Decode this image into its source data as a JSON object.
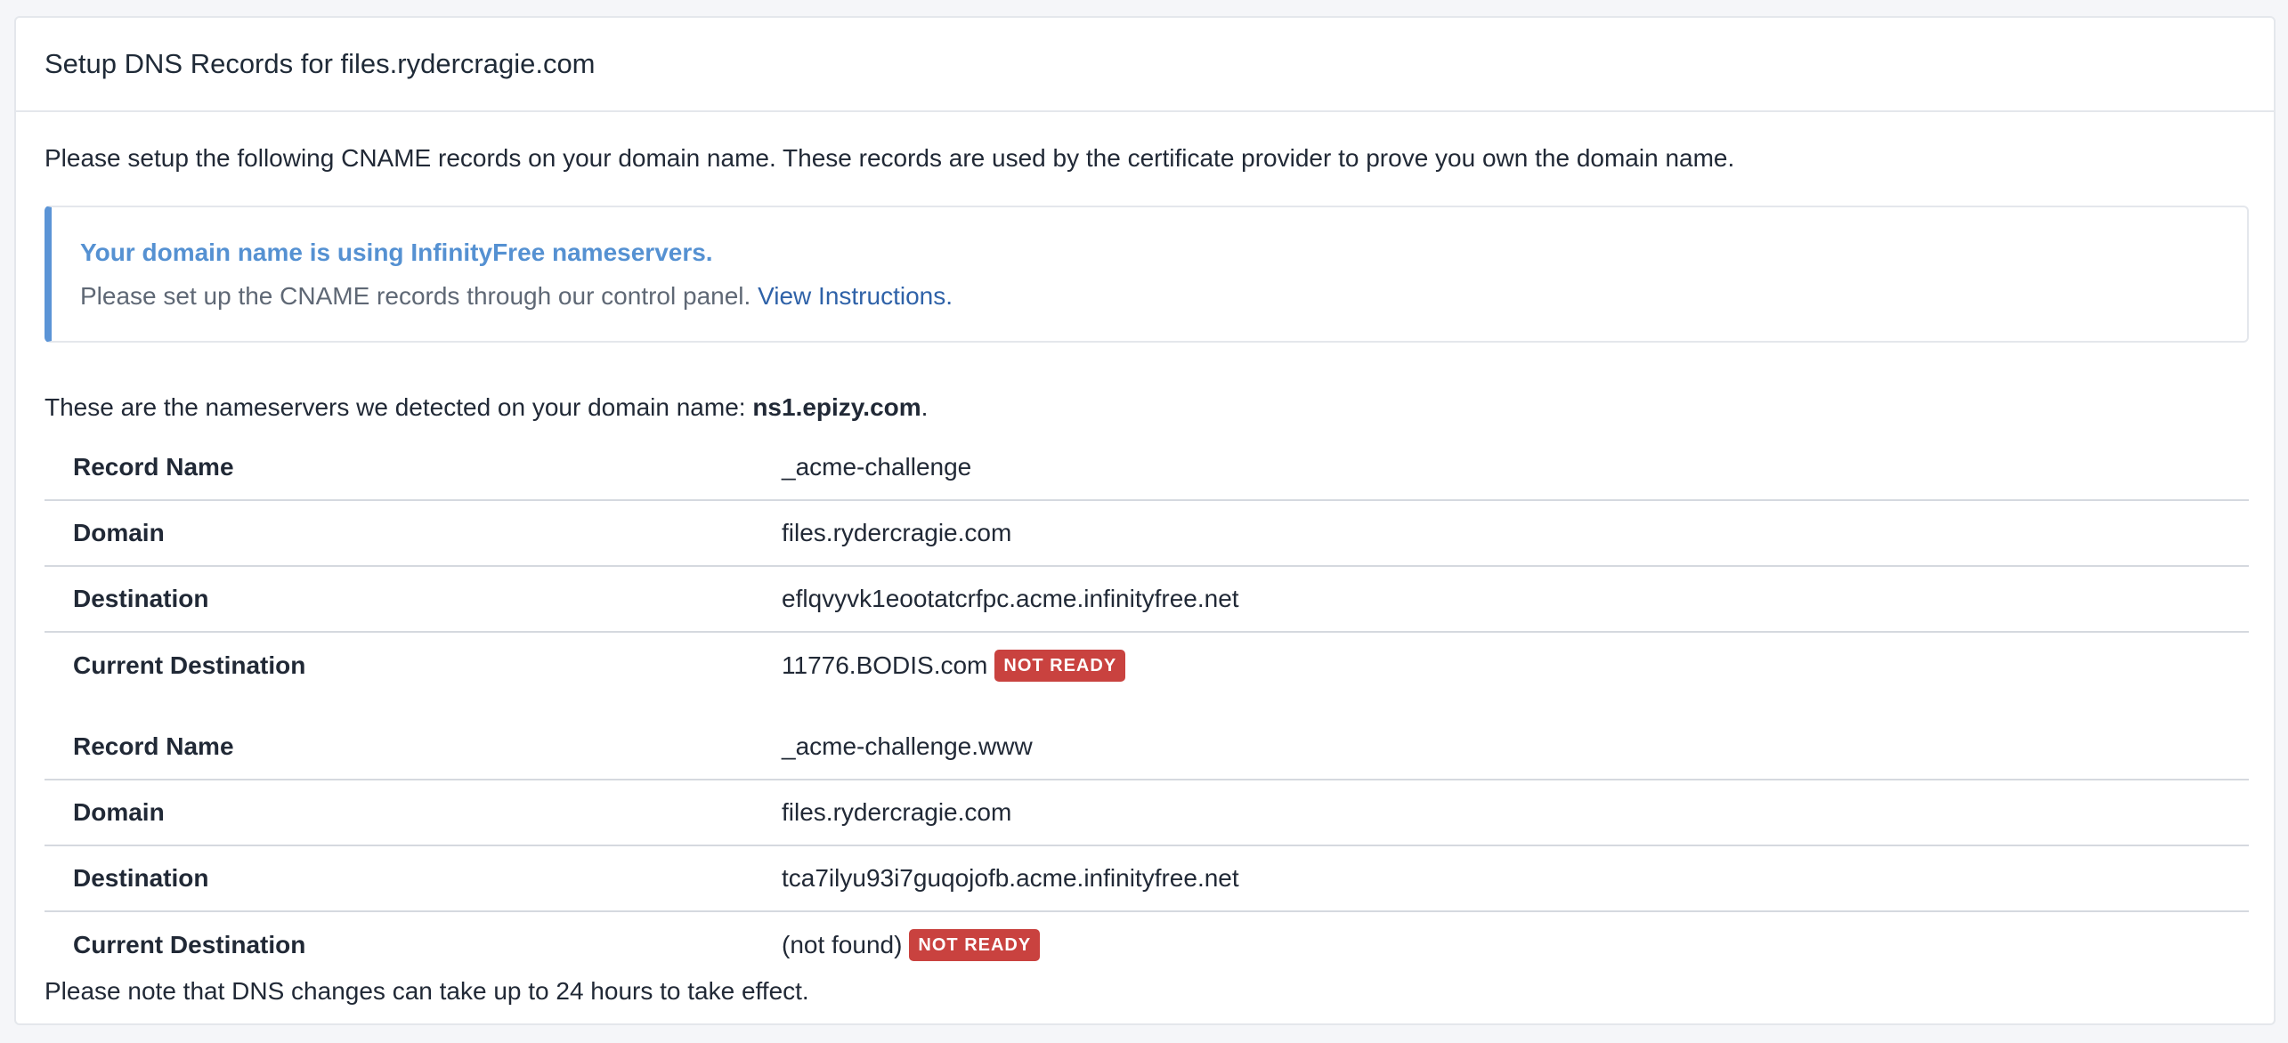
{
  "card": {
    "title": "Setup DNS Records for files.rydercragie.com"
  },
  "intro_text": "Please setup the following CNAME records on your domain name. These records are used by the certificate provider to prove you own the domain name.",
  "alert": {
    "title": "Your domain name is using InfinityFree nameservers.",
    "text": "Please set up the CNAME records through our control panel.",
    "link_label": "View Instructions."
  },
  "nameservers": {
    "prefix": "These are the nameservers we detected on your domain name:",
    "value": "ns1.epizy.com",
    "suffix": "."
  },
  "records": [
    {
      "rows": [
        {
          "label": "Record Name",
          "value": "_acme-challenge"
        },
        {
          "label": "Domain",
          "value": "files.rydercragie.com"
        },
        {
          "label": "Destination",
          "value": "eflqvyvk1eootatcrfpc.acme.infinityfree.net"
        },
        {
          "label": "Current Destination",
          "value": "11776.BODIS.com",
          "badge": "NOT READY"
        }
      ]
    },
    {
      "rows": [
        {
          "label": "Record Name",
          "value": "_acme-challenge.www"
        },
        {
          "label": "Domain",
          "value": "files.rydercragie.com"
        },
        {
          "label": "Destination",
          "value": "tca7ilyu93i7guqojofb.acme.infinityfree.net"
        },
        {
          "label": "Current Destination",
          "value": "(not found)",
          "badge": "NOT READY"
        }
      ]
    }
  ],
  "footer_note": "Please note that DNS changes can take up to 24 hours to take effect."
}
